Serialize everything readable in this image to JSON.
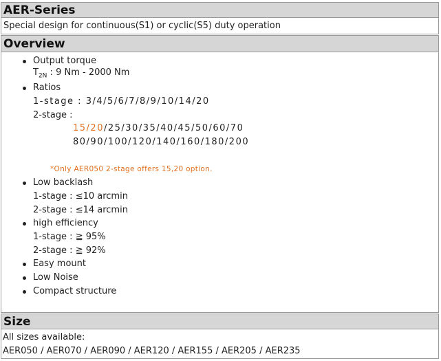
{
  "series": {
    "title": "AER-Series",
    "description": "Special design for continuous(S1) or cyclic(S5) duty operation"
  },
  "overview": {
    "title": "Overview",
    "output_torque": {
      "label": "Output torque",
      "symbol": "T",
      "subscript": "2N",
      "value": " : 9 Nm - 2000 Nm"
    },
    "ratios": {
      "label": "Ratios",
      "stage1": "1-stage : 3/4/5/6/7/8/9/10/14/20",
      "stage2_label": "2-stage :",
      "stage2_highlight": "15/20",
      "stage2_line1_rest": "/25/30/35/40/45/50/60/70",
      "stage2_line2": "80/90/100/120/140/160/180/200",
      "note": "*Only AER050 2-stage offers 15,20 option."
    },
    "backlash": {
      "label": "Low backlash",
      "stage1": "1-stage : ≤10 arcmin",
      "stage2": "2-stage : ≤14 arcmin"
    },
    "efficiency": {
      "label": "high efficiency",
      "stage1": "1-stage :  ≧ 95%",
      "stage2": "2-stage :  ≧ 92%"
    },
    "features": [
      "Easy mount",
      "Low Noise",
      "Compact structure"
    ]
  },
  "size": {
    "title": "Size",
    "intro": "All sizes available:",
    "list": "AER050 / AER070 / AER090 / AER120 / AER155 / AER205 / AER235"
  },
  "colors": {
    "header_bg": "#d6d6d6",
    "border": "#9a9a9a",
    "highlight": "#e07020"
  }
}
